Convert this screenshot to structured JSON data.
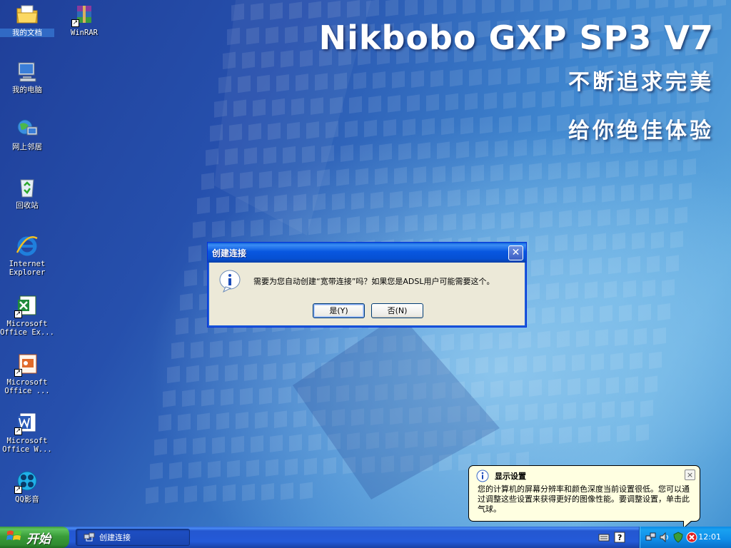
{
  "wallpaper": {
    "title": "Nikbobo GXP SP3 V7",
    "line1": "不断追求完美",
    "line2": "给你绝佳体验"
  },
  "desktop_icons": [
    {
      "label": "我的文档",
      "icon": "my-documents-icon"
    },
    {
      "label": "WinRAR",
      "icon": "winrar-icon"
    },
    {
      "label": "我的电脑",
      "icon": "my-computer-icon"
    },
    {
      "label": "网上邻居",
      "icon": "network-places-icon"
    },
    {
      "label": "回收站",
      "icon": "recycle-bin-icon"
    },
    {
      "label": "Internet Explorer",
      "icon": "internet-explorer-icon"
    },
    {
      "label": "Microsoft Office Ex...",
      "icon": "excel-icon"
    },
    {
      "label": "Microsoft Office ...",
      "icon": "powerpoint-icon"
    },
    {
      "label": "Microsoft Office W...",
      "icon": "word-icon"
    },
    {
      "label": "QQ影音",
      "icon": "qq-player-icon"
    }
  ],
  "dialog": {
    "title": "创建连接",
    "message": "需要为您自动创建“宽带连接”吗？如果您是ADSL用户可能需要这个。",
    "yes_label": "是(Y)",
    "no_label": "否(N)",
    "close_glyph": "✕"
  },
  "balloon": {
    "title": "显示设置",
    "text": "您的计算机的屏幕分辨率和颜色深度当前设置很低。您可以通过调整这些设置来获得更好的图像性能。要调整设置，单击此气球。",
    "close_glyph": "×"
  },
  "taskbar": {
    "start_label": "开始",
    "task_label": "创建连接",
    "clock": "12:01"
  },
  "colors": {
    "xp_blue": "#0a5fd8",
    "start_green": "#3a9d3a",
    "tray_blue": "#0f8de8",
    "balloon_bg": "#ffffe1"
  }
}
